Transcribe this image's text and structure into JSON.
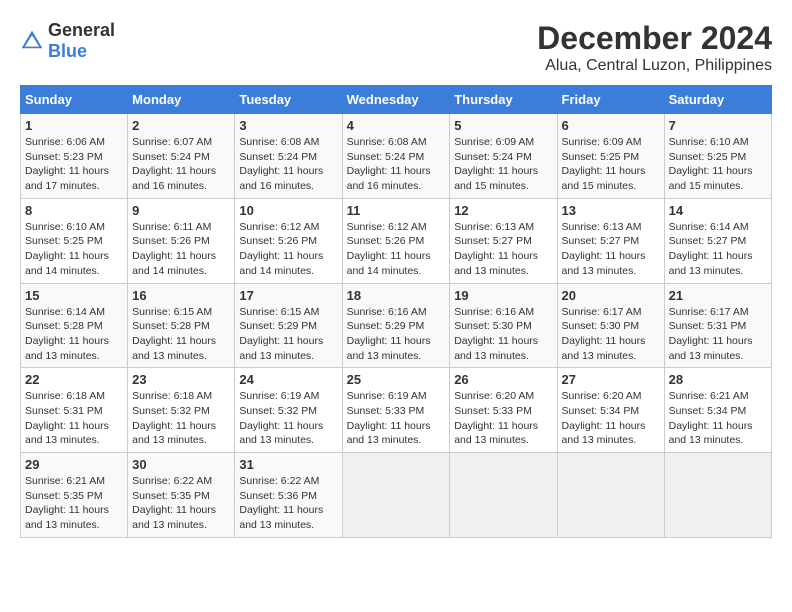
{
  "header": {
    "logo_general": "General",
    "logo_blue": "Blue",
    "title": "December 2024",
    "subtitle": "Alua, Central Luzon, Philippines"
  },
  "calendar": {
    "days_of_week": [
      "Sunday",
      "Monday",
      "Tuesday",
      "Wednesday",
      "Thursday",
      "Friday",
      "Saturday"
    ],
    "weeks": [
      [
        {
          "day": "",
          "empty": true
        },
        {
          "day": "",
          "empty": true
        },
        {
          "day": "",
          "empty": true
        },
        {
          "day": "",
          "empty": true
        },
        {
          "day": "5",
          "sunrise": "6:09 AM",
          "sunset": "5:24 PM",
          "daylight": "11 hours and 15 minutes."
        },
        {
          "day": "6",
          "sunrise": "6:09 AM",
          "sunset": "5:25 PM",
          "daylight": "11 hours and 15 minutes."
        },
        {
          "day": "7",
          "sunrise": "6:10 AM",
          "sunset": "5:25 PM",
          "daylight": "11 hours and 15 minutes."
        }
      ],
      [
        {
          "day": "1",
          "sunrise": "6:06 AM",
          "sunset": "5:23 PM",
          "daylight": "11 hours and 17 minutes."
        },
        {
          "day": "2",
          "sunrise": "6:07 AM",
          "sunset": "5:24 PM",
          "daylight": "11 hours and 16 minutes."
        },
        {
          "day": "3",
          "sunrise": "6:08 AM",
          "sunset": "5:24 PM",
          "daylight": "11 hours and 16 minutes."
        },
        {
          "day": "4",
          "sunrise": "6:08 AM",
          "sunset": "5:24 PM",
          "daylight": "11 hours and 16 minutes."
        },
        {
          "day": "5",
          "sunrise": "6:09 AM",
          "sunset": "5:24 PM",
          "daylight": "11 hours and 15 minutes."
        },
        {
          "day": "6",
          "sunrise": "6:09 AM",
          "sunset": "5:25 PM",
          "daylight": "11 hours and 15 minutes."
        },
        {
          "day": "7",
          "sunrise": "6:10 AM",
          "sunset": "5:25 PM",
          "daylight": "11 hours and 15 minutes."
        }
      ],
      [
        {
          "day": "8",
          "sunrise": "6:10 AM",
          "sunset": "5:25 PM",
          "daylight": "11 hours and 14 minutes."
        },
        {
          "day": "9",
          "sunrise": "6:11 AM",
          "sunset": "5:26 PM",
          "daylight": "11 hours and 14 minutes."
        },
        {
          "day": "10",
          "sunrise": "6:12 AM",
          "sunset": "5:26 PM",
          "daylight": "11 hours and 14 minutes."
        },
        {
          "day": "11",
          "sunrise": "6:12 AM",
          "sunset": "5:26 PM",
          "daylight": "11 hours and 14 minutes."
        },
        {
          "day": "12",
          "sunrise": "6:13 AM",
          "sunset": "5:27 PM",
          "daylight": "11 hours and 13 minutes."
        },
        {
          "day": "13",
          "sunrise": "6:13 AM",
          "sunset": "5:27 PM",
          "daylight": "11 hours and 13 minutes."
        },
        {
          "day": "14",
          "sunrise": "6:14 AM",
          "sunset": "5:27 PM",
          "daylight": "11 hours and 13 minutes."
        }
      ],
      [
        {
          "day": "15",
          "sunrise": "6:14 AM",
          "sunset": "5:28 PM",
          "daylight": "11 hours and 13 minutes."
        },
        {
          "day": "16",
          "sunrise": "6:15 AM",
          "sunset": "5:28 PM",
          "daylight": "11 hours and 13 minutes."
        },
        {
          "day": "17",
          "sunrise": "6:15 AM",
          "sunset": "5:29 PM",
          "daylight": "11 hours and 13 minutes."
        },
        {
          "day": "18",
          "sunrise": "6:16 AM",
          "sunset": "5:29 PM",
          "daylight": "11 hours and 13 minutes."
        },
        {
          "day": "19",
          "sunrise": "6:16 AM",
          "sunset": "5:30 PM",
          "daylight": "11 hours and 13 minutes."
        },
        {
          "day": "20",
          "sunrise": "6:17 AM",
          "sunset": "5:30 PM",
          "daylight": "11 hours and 13 minutes."
        },
        {
          "day": "21",
          "sunrise": "6:17 AM",
          "sunset": "5:31 PM",
          "daylight": "11 hours and 13 minutes."
        }
      ],
      [
        {
          "day": "22",
          "sunrise": "6:18 AM",
          "sunset": "5:31 PM",
          "daylight": "11 hours and 13 minutes."
        },
        {
          "day": "23",
          "sunrise": "6:18 AM",
          "sunset": "5:32 PM",
          "daylight": "11 hours and 13 minutes."
        },
        {
          "day": "24",
          "sunrise": "6:19 AM",
          "sunset": "5:32 PM",
          "daylight": "11 hours and 13 minutes."
        },
        {
          "day": "25",
          "sunrise": "6:19 AM",
          "sunset": "5:33 PM",
          "daylight": "11 hours and 13 minutes."
        },
        {
          "day": "26",
          "sunrise": "6:20 AM",
          "sunset": "5:33 PM",
          "daylight": "11 hours and 13 minutes."
        },
        {
          "day": "27",
          "sunrise": "6:20 AM",
          "sunset": "5:34 PM",
          "daylight": "11 hours and 13 minutes."
        },
        {
          "day": "28",
          "sunrise": "6:21 AM",
          "sunset": "5:34 PM",
          "daylight": "11 hours and 13 minutes."
        }
      ],
      [
        {
          "day": "29",
          "sunrise": "6:21 AM",
          "sunset": "5:35 PM",
          "daylight": "11 hours and 13 minutes."
        },
        {
          "day": "30",
          "sunrise": "6:22 AM",
          "sunset": "5:35 PM",
          "daylight": "11 hours and 13 minutes."
        },
        {
          "day": "31",
          "sunrise": "6:22 AM",
          "sunset": "5:36 PM",
          "daylight": "11 hours and 13 minutes."
        },
        {
          "day": "",
          "empty": true
        },
        {
          "day": "",
          "empty": true
        },
        {
          "day": "",
          "empty": true
        },
        {
          "day": "",
          "empty": true
        }
      ]
    ]
  },
  "labels": {
    "sunrise_prefix": "Sunrise: ",
    "sunset_prefix": "Sunset: ",
    "daylight_prefix": "Daylight: "
  }
}
